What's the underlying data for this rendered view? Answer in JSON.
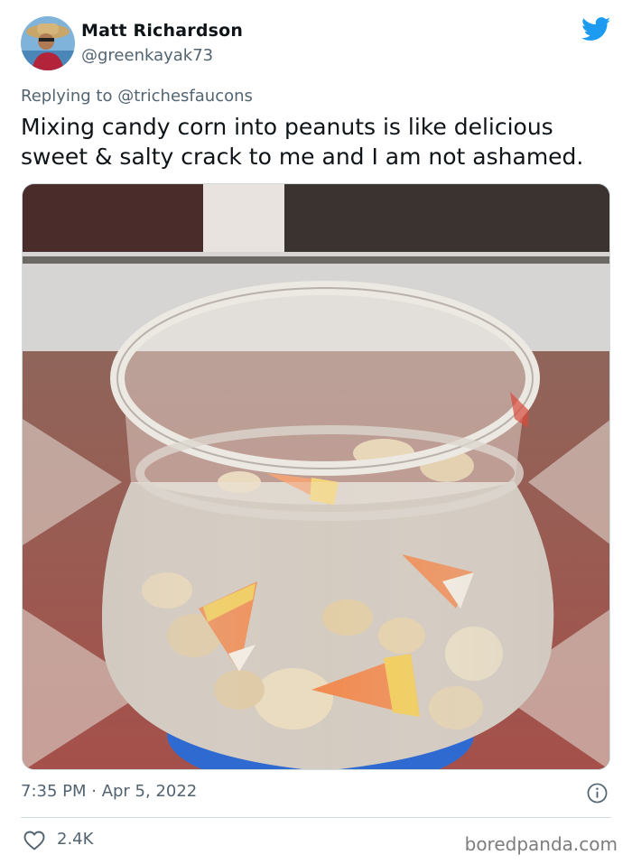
{
  "author": {
    "name": "Matt Richardson",
    "handle": "@greenkayak73"
  },
  "reply": {
    "prefix": "Replying to ",
    "mention": "@trichesfaucons"
  },
  "tweet": {
    "text": "Mixing candy corn into peanuts is like delicious sweet & salty crack to me and I am not ashamed."
  },
  "meta": {
    "timestamp": "7:35 PM · Apr 5, 2022",
    "likes": "2.4K"
  },
  "watermark": "boredpanda.com",
  "icons": {
    "logo": "twitter-bird-icon",
    "info": "info-icon",
    "like": "heart-icon"
  },
  "colors": {
    "brand": "#1d9bf0",
    "text": "#0f1419",
    "secondary": "#536471",
    "divider": "#cfd9de"
  }
}
